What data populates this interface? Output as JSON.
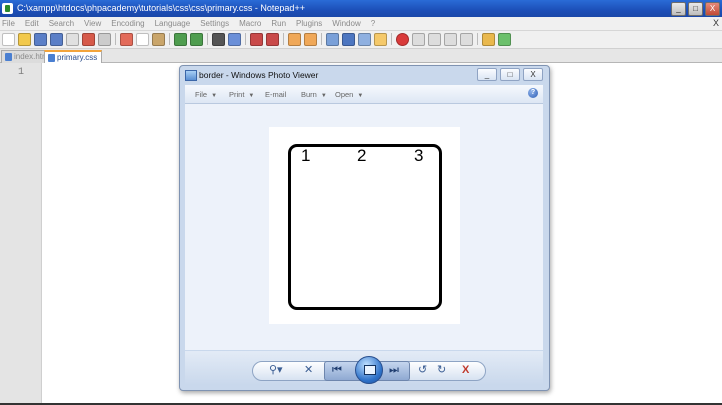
{
  "notepad": {
    "title": "C:\\xampp\\htdocs\\phpacademy\\tutorials\\css\\css\\primary.css - Notepad++",
    "window_buttons": [
      "_",
      "□",
      "X"
    ],
    "menu": [
      "File",
      "Edit",
      "Search",
      "View",
      "Encoding",
      "Language",
      "Settings",
      "Macro",
      "Run",
      "Plugins",
      "Window",
      "?"
    ],
    "menu_close": "X",
    "tabs": [
      {
        "label": "index.html",
        "active": false
      },
      {
        "label": "primary.css",
        "active": true
      }
    ],
    "line_number": "1"
  },
  "photo_viewer": {
    "title": "border - Windows Photo Viewer",
    "window_buttons": [
      "_",
      "□",
      "X"
    ],
    "menu": [
      {
        "label": "File",
        "has_caret": true
      },
      {
        "label": "Print",
        "has_caret": true
      },
      {
        "label": "E-mail",
        "has_caret": false
      },
      {
        "label": "Burn",
        "has_caret": true
      },
      {
        "label": "Open",
        "has_caret": true
      }
    ],
    "help": "?",
    "image_numbers": [
      "1",
      "2",
      "3"
    ],
    "controls": {
      "zoom": "⚲▾",
      "actual_size": "✕",
      "previous": "⏮",
      "next": "⏭",
      "rotate_ccw": "↺",
      "rotate_cw": "↻",
      "delete": "X"
    }
  },
  "colors": {
    "titlebar": "#1c4fb8",
    "active_tab_accent": "#f3a43b",
    "viewer_frame": "#c9d8ec"
  }
}
